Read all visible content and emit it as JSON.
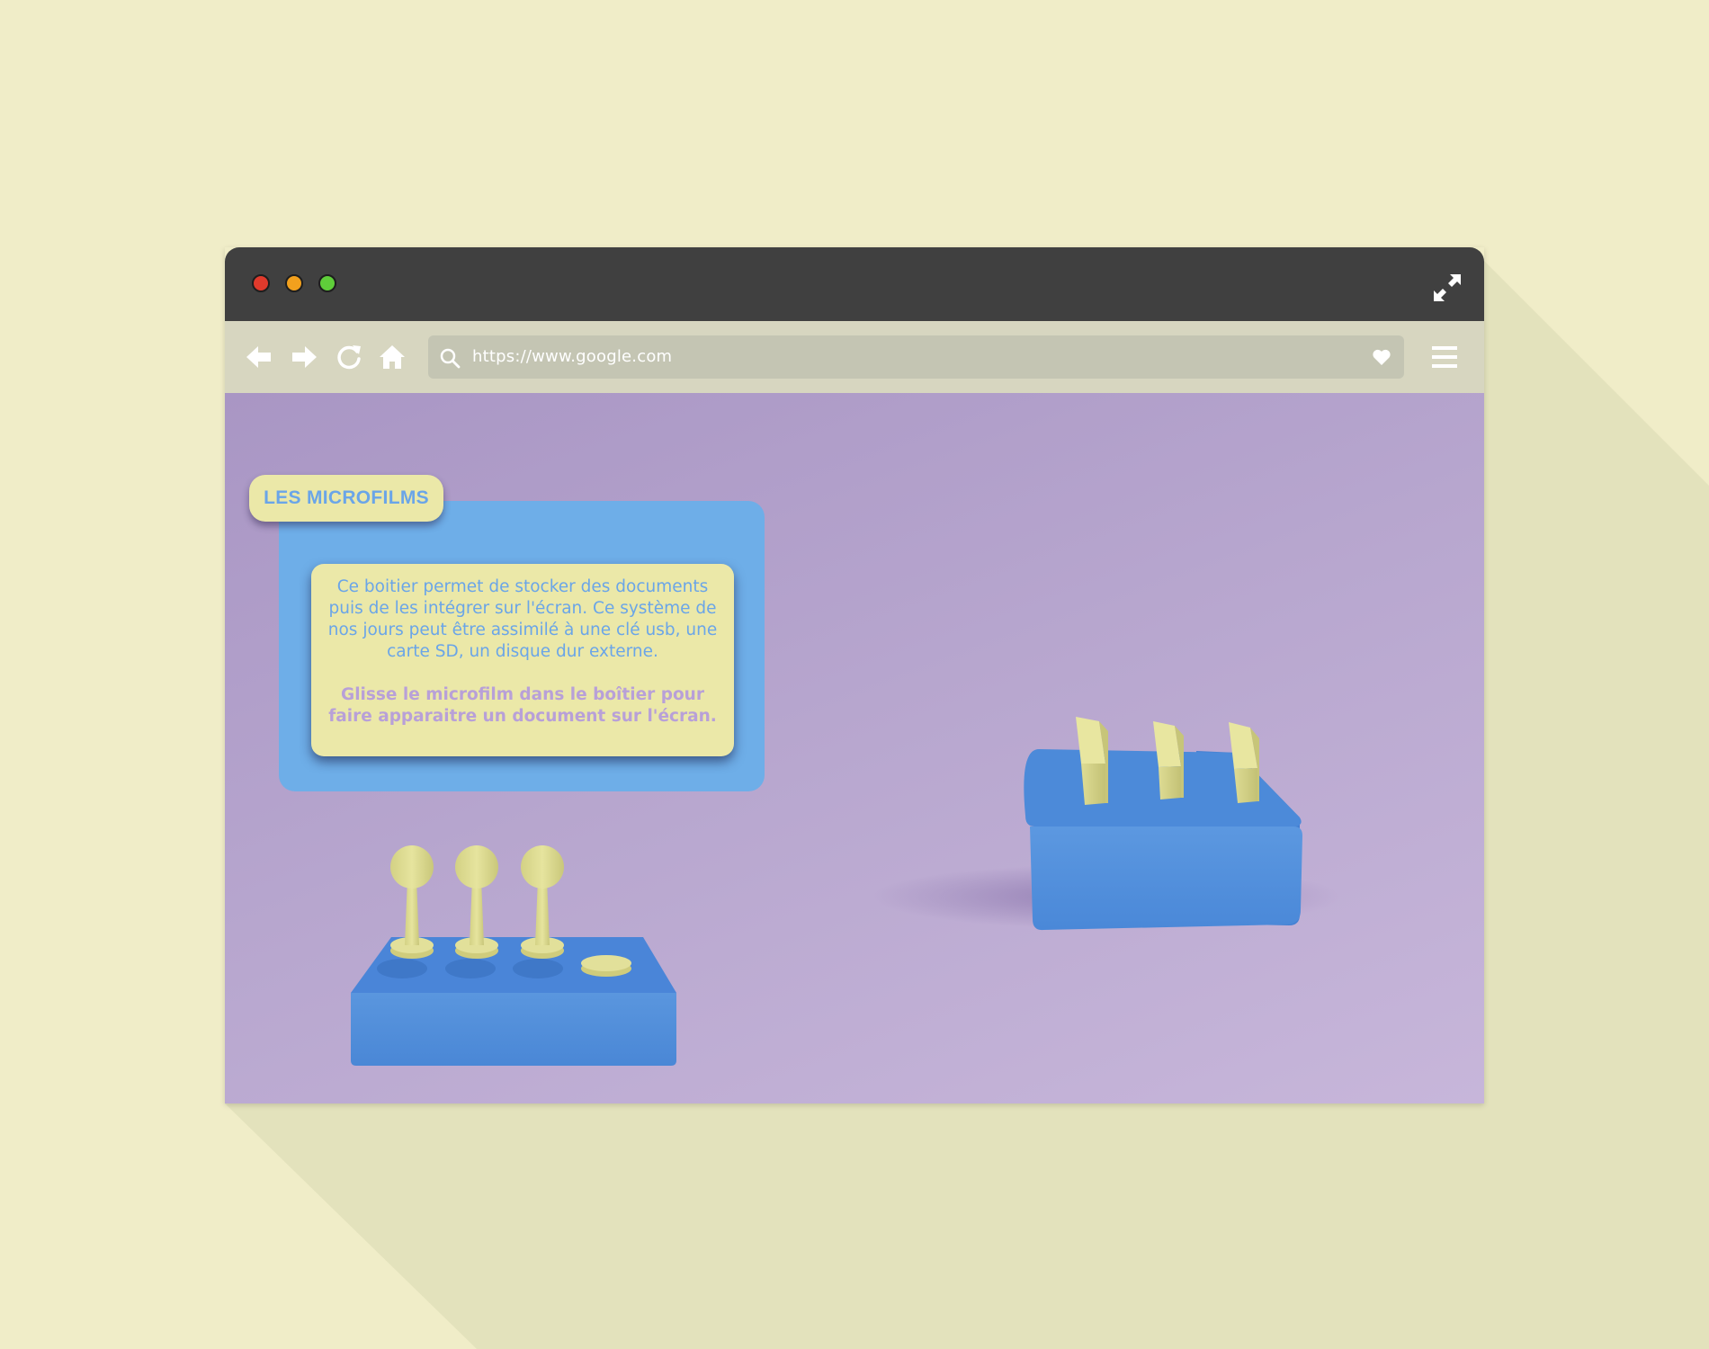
{
  "browser": {
    "window_controls": [
      {
        "name": "close",
        "color": "#e03a2c"
      },
      {
        "name": "minimize",
        "color": "#f2a01d"
      },
      {
        "name": "maximize",
        "color": "#5fce3a"
      }
    ],
    "toolbar": {
      "icons": [
        "back-arrow-icon",
        "forward-arrow-icon",
        "reload-icon",
        "home-icon"
      ],
      "address_bar": {
        "url": "https://www.google.com"
      },
      "bookmark_icon": "heart-icon",
      "menu_icon": "hamburger-menu-icon"
    }
  },
  "page": {
    "tag_label": "LES MICROFILMS",
    "description": "Ce boitier permet de stocker des documents puis de les intégrer sur l'écran. Ce système de nos jours peut être assimilé à une clé usb, une carte SD, un disque dur externe.",
    "call_to_action": "Glisse le microfilm dans le boîtier pour faire apparaitre un document sur l'écran."
  },
  "colors": {
    "background": "#f0edc8",
    "titlebar": "#404040",
    "toolbar": "#d7d6c0",
    "content": "#b8a7cf",
    "panel_blue": "#6eaee8",
    "card_yellow": "#ebe8a8",
    "object_blue": "#4a8bd8"
  }
}
